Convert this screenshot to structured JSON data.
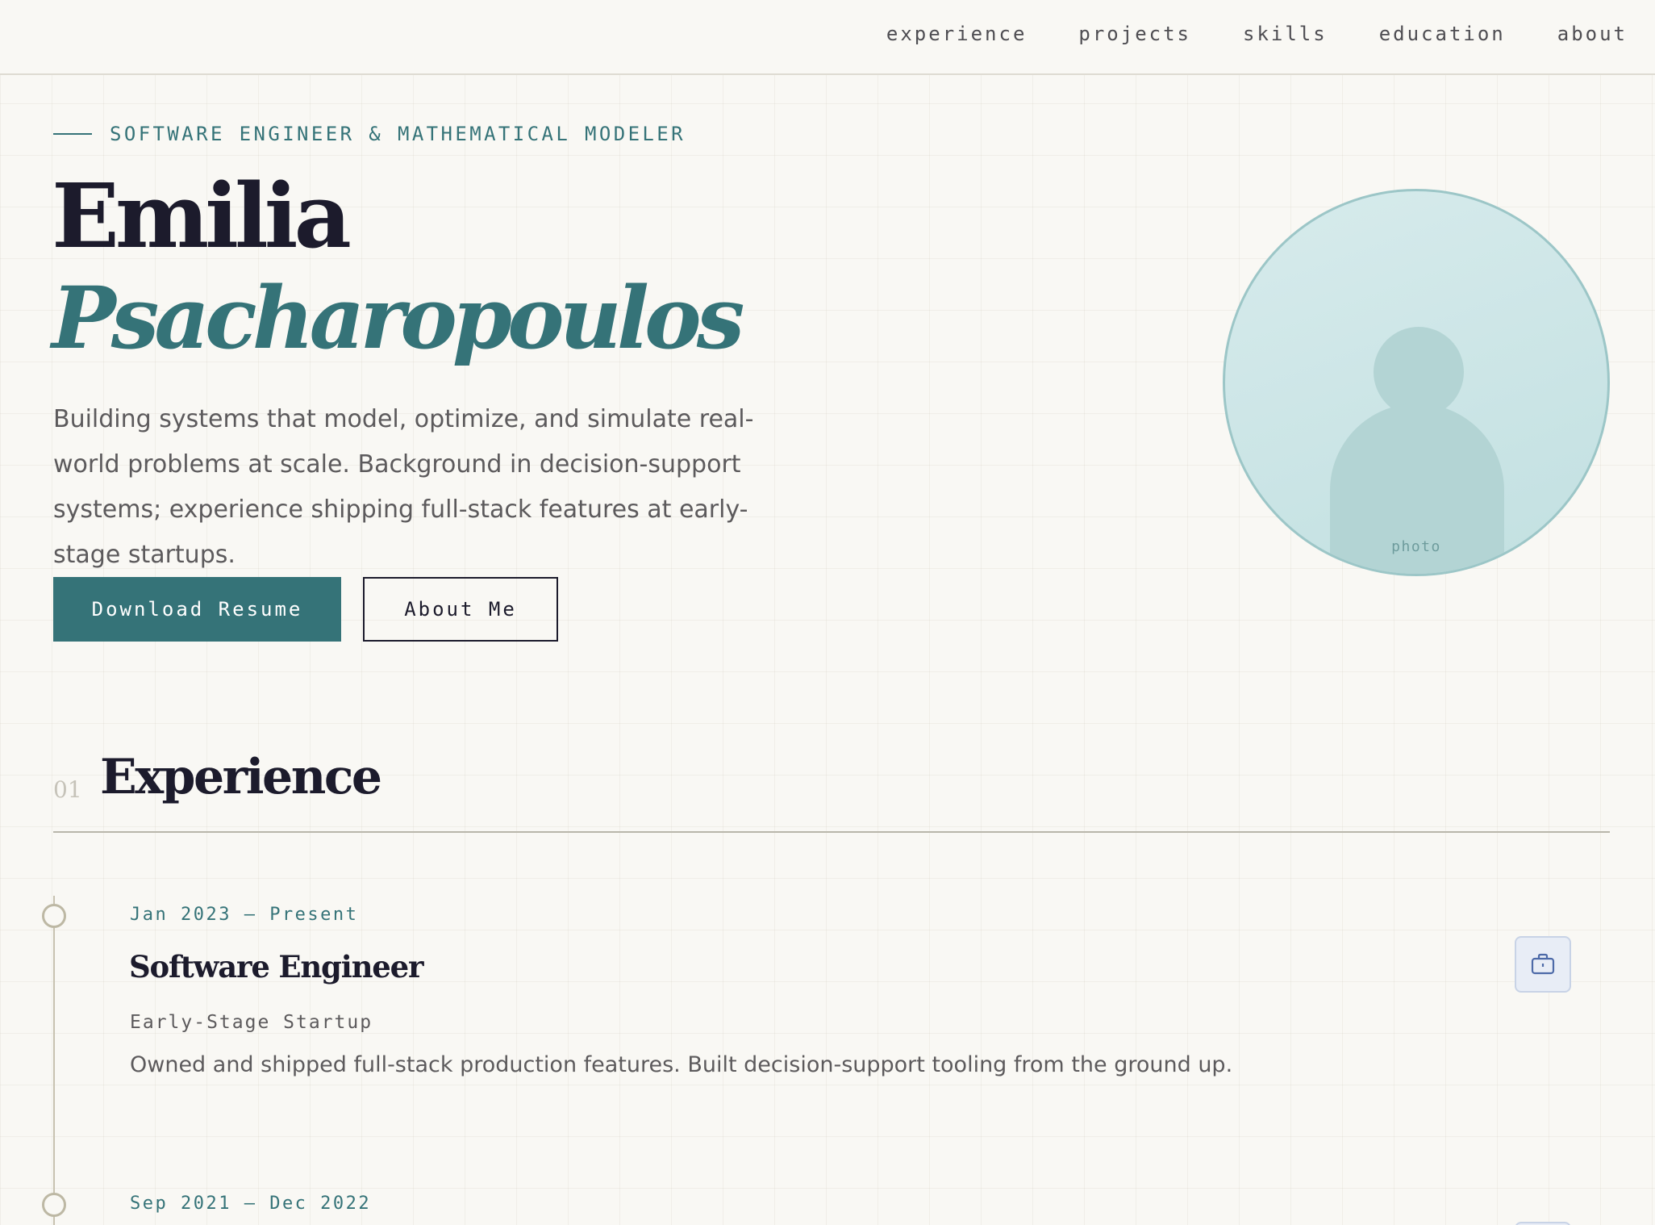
{
  "nav": {
    "links": [
      "experience",
      "projects",
      "skills",
      "education",
      "about"
    ]
  },
  "hero": {
    "eyebrow": "SOFTWARE ENGINEER & MATHEMATICAL MODELER",
    "first_name": "Emilia",
    "last_name": "Psacharopoulos",
    "tagline": "Building systems that model, optimize, and simulate real-world problems at scale. Background in decision-support systems; experience shipping full-stack features at early-stage startups.",
    "primary_button": "Download Resume",
    "secondary_button": "About Me",
    "avatar_label": "photo"
  },
  "experience": {
    "number": "01",
    "title": "Experience",
    "items": [
      {
        "date": "Jan 2023 — Present",
        "role": "Software Engineer",
        "company": "Early-Stage Startup",
        "description": "Owned and shipped full-stack production features. Built decision-support tooling from the ground up.",
        "icon": "briefcase-icon"
      },
      {
        "date": "Sep 2021 — Dec 2022"
      }
    ]
  },
  "colors": {
    "accent": "#357378",
    "ink": "#1c1b2c",
    "background": "#f9f8f4",
    "muted_text": "#5c5a5c"
  }
}
